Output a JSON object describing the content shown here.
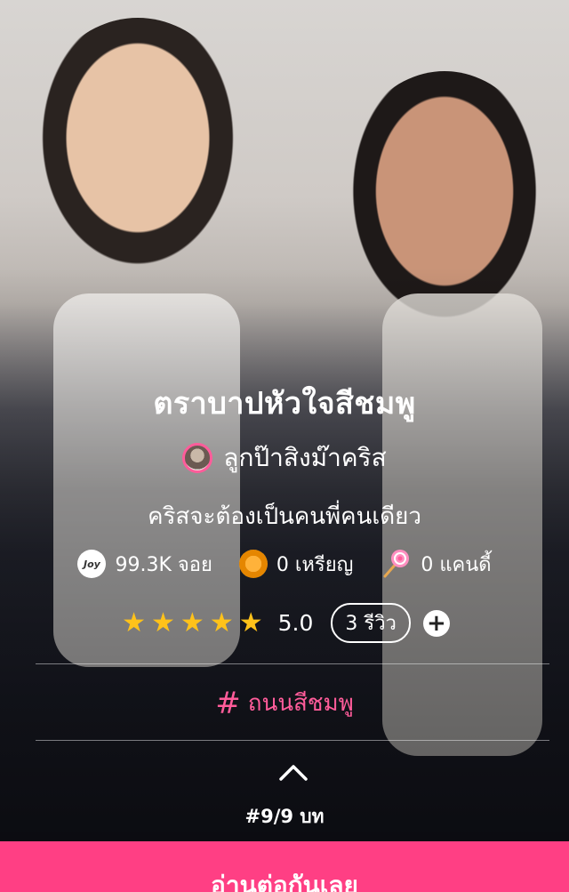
{
  "story": {
    "title": "ตราบาปหัวใจสีชมพู",
    "author": "ลูกป๊าสิงม๊าคริส",
    "subtitle": "คริสจะต้องเป็นคนพี่คนเดียว"
  },
  "stats": {
    "joy_icon_text": "Joy",
    "joy": "99.3K จอย",
    "coins": "0 เหรียญ",
    "candy": "0 แคนดี้"
  },
  "rating": {
    "stars": 5,
    "score": "5.0",
    "reviews": "3 รีวิว",
    "add_label": "+"
  },
  "tag": {
    "hash": "#",
    "label": "ถนนสีชมพู"
  },
  "chapter": "#9/9 บท",
  "cta_label": "อ่านต่อกันเลย",
  "colors": {
    "accent_pink": "#ff3f84",
    "tag_pink": "#ff5c9a",
    "star_gold": "#ffc21a"
  },
  "icons": [
    "joy-icon",
    "coin-icon",
    "candy-icon",
    "star-icon",
    "plus-icon",
    "chevron-up-icon",
    "hash-icon"
  ]
}
